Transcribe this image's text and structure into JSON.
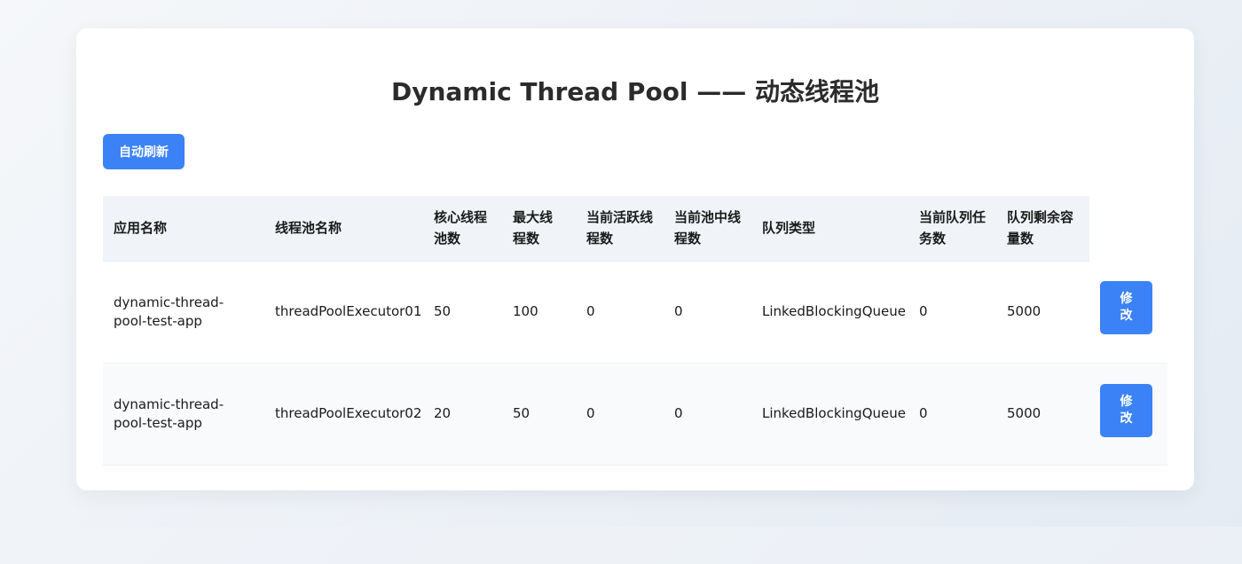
{
  "page": {
    "title": "Dynamic Thread Pool —— 动态线程池",
    "refresh_label": "自动刷新"
  },
  "table": {
    "headers": {
      "app_name": "应用名称",
      "pool_name": "线程池名称",
      "core_size": "核心线程池数",
      "max_size": "最大线程数",
      "active_count": "当前活跃线程数",
      "pool_size": "当前池中线程数",
      "queue_type": "队列类型",
      "queue_size": "当前队列任务数",
      "remaining_capacity": "队列剩余容量数"
    },
    "rows": [
      {
        "app_name": "dynamic-thread-pool-test-app",
        "pool_name": "threadPoolExecutor01",
        "core_size": "50",
        "max_size": "100",
        "active_count": "0",
        "pool_size": "0",
        "queue_type": "LinkedBlockingQueue",
        "queue_size": "0",
        "remaining_capacity": "5000",
        "edit_label": "修改"
      },
      {
        "app_name": "dynamic-thread-pool-test-app",
        "pool_name": "threadPoolExecutor02",
        "core_size": "20",
        "max_size": "50",
        "active_count": "0",
        "pool_size": "0",
        "queue_type": "LinkedBlockingQueue",
        "queue_size": "0",
        "remaining_capacity": "5000",
        "edit_label": "修改"
      }
    ]
  },
  "colors": {
    "accent": "#3b82f6",
    "header_bg": "#f0f4f9",
    "alt_row_bg": "#f8fafc"
  }
}
